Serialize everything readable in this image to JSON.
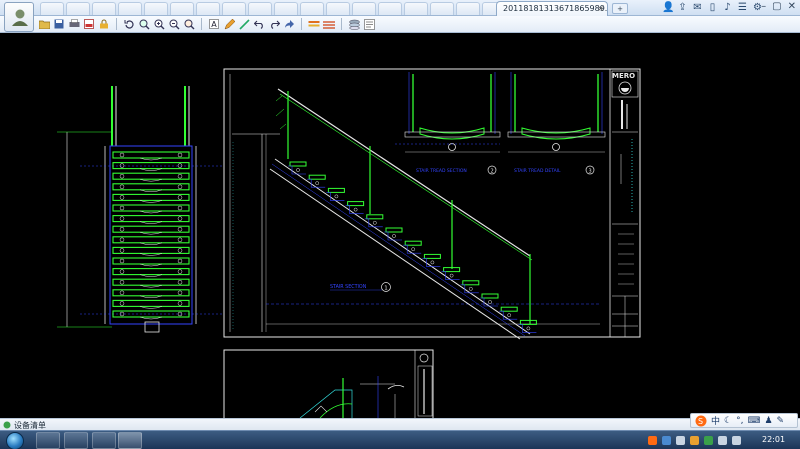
{
  "window": {
    "tab_title": "20118181313671865989.d...",
    "tab_close": "×",
    "new_tab": "+"
  },
  "toolbar": {
    "buttons": [
      "open-icon",
      "save-icon",
      "print-icon",
      "pdf-icon",
      "lock-icon",
      "rotate-icon",
      "zoom-window-icon",
      "zoom-in-icon",
      "zoom-out-icon",
      "text-icon",
      "pencil-icon",
      "measure-icon",
      "undo-icon",
      "redo-icon",
      "layer-icon",
      "color-icon",
      "layers-stack-icon",
      "compare-icon"
    ]
  },
  "drawing": {
    "main_section_label": "STAIR SECTION",
    "main_section_num": "1",
    "tread_section_label": "STAIR TREAD SECTION",
    "tread_section_num": "2",
    "tread_detail_label": "STAIR TREAD DETAIL",
    "tread_detail_num": "3",
    "brand": "MERO"
  },
  "colors": {
    "cad_green": "#33ff33",
    "cad_blue": "#3344ff",
    "cad_white": "#e8e8e8",
    "cad_cyan": "#33dddd"
  },
  "status": {
    "equipment_list": "设备清单"
  },
  "ime": {
    "mode": "中"
  },
  "taskbar": {
    "clock": "22:01"
  }
}
